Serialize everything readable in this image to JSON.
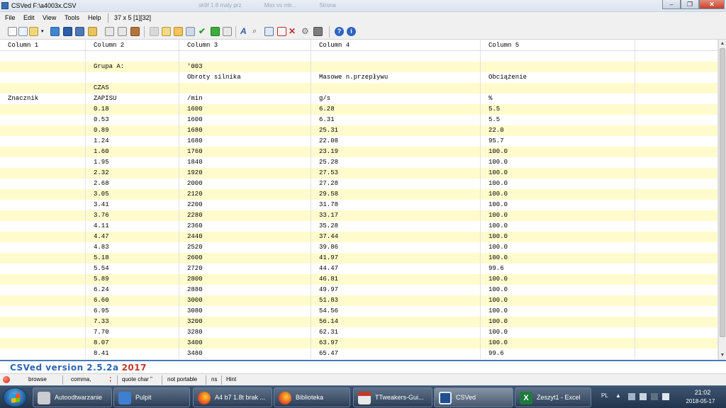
{
  "window": {
    "title": "CSVed F:\\a4003x.CSV",
    "background_tabs": [
      "sk9f 1.8 maly prz",
      "Max vs mb...",
      "Strona"
    ]
  },
  "menu": {
    "items": [
      "File",
      "Edit",
      "View",
      "Tools",
      "Help"
    ],
    "grid_info": "37 x 5 [1][32]"
  },
  "toolbar": {
    "icons": [
      "new-file-icon",
      "copy-icon",
      "open-icon",
      "dropdown-arrow-icon",
      "refresh-icon",
      "save-icon",
      "save-as-icon",
      "undo-icon",
      "columns-icon",
      "rows-icon",
      "book-icon",
      "disabled-icon",
      "paste-icon",
      "bookmark-icon",
      "grid-icon",
      "check-icon",
      "accept-icon",
      "add-icon",
      "font-icon",
      "search-icon",
      "table-icon",
      "remove-icon",
      "delete-icon",
      "settings-icon",
      "grid-view-icon",
      "help-icon",
      "info-icon"
    ]
  },
  "grid": {
    "headers": [
      "Column 1",
      "Column 2",
      "Column 3",
      "Column 4",
      "Column 5"
    ],
    "rows": [
      [
        "",
        "",
        "",
        "",
        ""
      ],
      [
        "",
        "Grupa A:",
        "'003",
        "",
        ""
      ],
      [
        "",
        "",
        "Obroty silnika",
        "Masowe n.przepływu",
        "Obciążenie"
      ],
      [
        "",
        "CZAS",
        "",
        "",
        ""
      ],
      [
        "Znacznik",
        "ZAPISU",
        " /min",
        " g/s",
        " %"
      ],
      [
        "",
        "0.18",
        "1600",
        "6.28",
        "5.5"
      ],
      [
        "",
        "0.53",
        "1600",
        "6.31",
        "5.5"
      ],
      [
        "",
        "0.89",
        "1680",
        "25.31",
        "22.0"
      ],
      [
        "",
        "1.24",
        "1680",
        "22.08",
        "95.7"
      ],
      [
        "",
        "1.60",
        "1760",
        "23.19",
        "100.0"
      ],
      [
        "",
        "1.95",
        "1840",
        "25.28",
        "100.0"
      ],
      [
        "",
        "2.32",
        "1920",
        "27.53",
        "100.0"
      ],
      [
        "",
        "2.68",
        "2000",
        "27.28",
        "100.0"
      ],
      [
        "",
        "3.05",
        "2120",
        "29.58",
        "100.0"
      ],
      [
        "",
        "3.41",
        "2200",
        "31.78",
        "100.0"
      ],
      [
        "",
        "3.76",
        "2280",
        "33.17",
        "100.0"
      ],
      [
        "",
        "4.11",
        "2360",
        "35.28",
        "100.0"
      ],
      [
        "",
        "4.47",
        "2440",
        "37.44",
        "100.0"
      ],
      [
        "",
        "4.83",
        "2520",
        "39.86",
        "100.0"
      ],
      [
        "",
        "5.18",
        "2600",
        "41.97",
        "100.0"
      ],
      [
        "",
        "5.54",
        "2720",
        "44.47",
        "99.6"
      ],
      [
        "",
        "5.89",
        "2800",
        "46.81",
        "100.0"
      ],
      [
        "",
        "6.24",
        "2880",
        "49.97",
        "100.0"
      ],
      [
        "",
        "6.60",
        "3000",
        "51.83",
        "100.0"
      ],
      [
        "",
        "6.95",
        "3080",
        "54.56",
        "100.0"
      ],
      [
        "",
        "7.33",
        "3200",
        "56.14",
        "100.0"
      ],
      [
        "",
        "7.70",
        "3280",
        "62.31",
        "100.0"
      ],
      [
        "",
        "8.07",
        "3400",
        "63.97",
        "100.0"
      ],
      [
        "",
        "8.41",
        "3480",
        "65.47",
        "99.6"
      ]
    ]
  },
  "banner": {
    "version": "CSVed version 2.5.2a",
    "year": "2017"
  },
  "statusbar": {
    "mode": "browse",
    "separator": "comma,",
    "marker": ";",
    "quote": "quote char \"",
    "portable": "not portable",
    "ns": "ns",
    "hint": "Hint"
  },
  "taskbar": {
    "tasks": [
      {
        "label": "Autoodtwarzanie",
        "icon": "drive-icon"
      },
      {
        "label": "Pulpit",
        "icon": "desktop-icon"
      },
      {
        "label": "A4 b7 1.8t brak ...",
        "icon": "firefox-icon"
      },
      {
        "label": "Biblioteka",
        "icon": "firefox-icon"
      },
      {
        "label": "TTweakers-Gui...",
        "icon": "pdf-icon"
      },
      {
        "label": "CSVed",
        "icon": "csved-icon"
      },
      {
        "label": "Zeszyt1 - Excel",
        "icon": "excel-icon"
      }
    ],
    "language": "PL",
    "time": "21:02",
    "date": "2018-05-17"
  },
  "colors": {
    "row_yellow": "#fffbcc",
    "accent_blue": "#2c64b4",
    "year_red": "#c0392b",
    "taskbar": "#2b3f5a"
  }
}
